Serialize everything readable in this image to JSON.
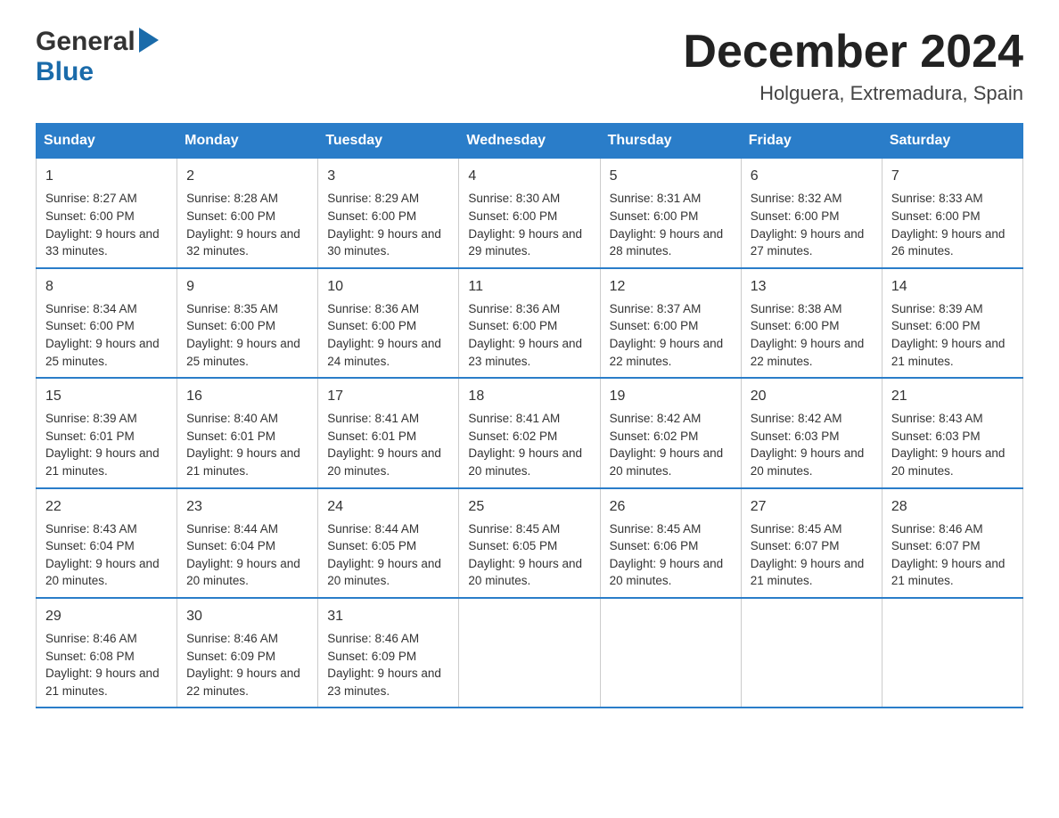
{
  "header": {
    "logo_general": "General",
    "logo_blue": "Blue",
    "month_year": "December 2024",
    "location": "Holguera, Extremadura, Spain"
  },
  "weekdays": [
    "Sunday",
    "Monday",
    "Tuesday",
    "Wednesday",
    "Thursday",
    "Friday",
    "Saturday"
  ],
  "weeks": [
    [
      {
        "day": "1",
        "sunrise": "8:27 AM",
        "sunset": "6:00 PM",
        "daylight": "9 hours and 33 minutes."
      },
      {
        "day": "2",
        "sunrise": "8:28 AM",
        "sunset": "6:00 PM",
        "daylight": "9 hours and 32 minutes."
      },
      {
        "day": "3",
        "sunrise": "8:29 AM",
        "sunset": "6:00 PM",
        "daylight": "9 hours and 30 minutes."
      },
      {
        "day": "4",
        "sunrise": "8:30 AM",
        "sunset": "6:00 PM",
        "daylight": "9 hours and 29 minutes."
      },
      {
        "day": "5",
        "sunrise": "8:31 AM",
        "sunset": "6:00 PM",
        "daylight": "9 hours and 28 minutes."
      },
      {
        "day": "6",
        "sunrise": "8:32 AM",
        "sunset": "6:00 PM",
        "daylight": "9 hours and 27 minutes."
      },
      {
        "day": "7",
        "sunrise": "8:33 AM",
        "sunset": "6:00 PM",
        "daylight": "9 hours and 26 minutes."
      }
    ],
    [
      {
        "day": "8",
        "sunrise": "8:34 AM",
        "sunset": "6:00 PM",
        "daylight": "9 hours and 25 minutes."
      },
      {
        "day": "9",
        "sunrise": "8:35 AM",
        "sunset": "6:00 PM",
        "daylight": "9 hours and 25 minutes."
      },
      {
        "day": "10",
        "sunrise": "8:36 AM",
        "sunset": "6:00 PM",
        "daylight": "9 hours and 24 minutes."
      },
      {
        "day": "11",
        "sunrise": "8:36 AM",
        "sunset": "6:00 PM",
        "daylight": "9 hours and 23 minutes."
      },
      {
        "day": "12",
        "sunrise": "8:37 AM",
        "sunset": "6:00 PM",
        "daylight": "9 hours and 22 minutes."
      },
      {
        "day": "13",
        "sunrise": "8:38 AM",
        "sunset": "6:00 PM",
        "daylight": "9 hours and 22 minutes."
      },
      {
        "day": "14",
        "sunrise": "8:39 AM",
        "sunset": "6:00 PM",
        "daylight": "9 hours and 21 minutes."
      }
    ],
    [
      {
        "day": "15",
        "sunrise": "8:39 AM",
        "sunset": "6:01 PM",
        "daylight": "9 hours and 21 minutes."
      },
      {
        "day": "16",
        "sunrise": "8:40 AM",
        "sunset": "6:01 PM",
        "daylight": "9 hours and 21 minutes."
      },
      {
        "day": "17",
        "sunrise": "8:41 AM",
        "sunset": "6:01 PM",
        "daylight": "9 hours and 20 minutes."
      },
      {
        "day": "18",
        "sunrise": "8:41 AM",
        "sunset": "6:02 PM",
        "daylight": "9 hours and 20 minutes."
      },
      {
        "day": "19",
        "sunrise": "8:42 AM",
        "sunset": "6:02 PM",
        "daylight": "9 hours and 20 minutes."
      },
      {
        "day": "20",
        "sunrise": "8:42 AM",
        "sunset": "6:03 PM",
        "daylight": "9 hours and 20 minutes."
      },
      {
        "day": "21",
        "sunrise": "8:43 AM",
        "sunset": "6:03 PM",
        "daylight": "9 hours and 20 minutes."
      }
    ],
    [
      {
        "day": "22",
        "sunrise": "8:43 AM",
        "sunset": "6:04 PM",
        "daylight": "9 hours and 20 minutes."
      },
      {
        "day": "23",
        "sunrise": "8:44 AM",
        "sunset": "6:04 PM",
        "daylight": "9 hours and 20 minutes."
      },
      {
        "day": "24",
        "sunrise": "8:44 AM",
        "sunset": "6:05 PM",
        "daylight": "9 hours and 20 minutes."
      },
      {
        "day": "25",
        "sunrise": "8:45 AM",
        "sunset": "6:05 PM",
        "daylight": "9 hours and 20 minutes."
      },
      {
        "day": "26",
        "sunrise": "8:45 AM",
        "sunset": "6:06 PM",
        "daylight": "9 hours and 20 minutes."
      },
      {
        "day": "27",
        "sunrise": "8:45 AM",
        "sunset": "6:07 PM",
        "daylight": "9 hours and 21 minutes."
      },
      {
        "day": "28",
        "sunrise": "8:46 AM",
        "sunset": "6:07 PM",
        "daylight": "9 hours and 21 minutes."
      }
    ],
    [
      {
        "day": "29",
        "sunrise": "8:46 AM",
        "sunset": "6:08 PM",
        "daylight": "9 hours and 21 minutes."
      },
      {
        "day": "30",
        "sunrise": "8:46 AM",
        "sunset": "6:09 PM",
        "daylight": "9 hours and 22 minutes."
      },
      {
        "day": "31",
        "sunrise": "8:46 AM",
        "sunset": "6:09 PM",
        "daylight": "9 hours and 23 minutes."
      },
      null,
      null,
      null,
      null
    ]
  ],
  "colors": {
    "header_bg": "#2a7dc9",
    "header_text": "#ffffff",
    "border": "#cccccc",
    "row_border": "#2a7dc9"
  }
}
